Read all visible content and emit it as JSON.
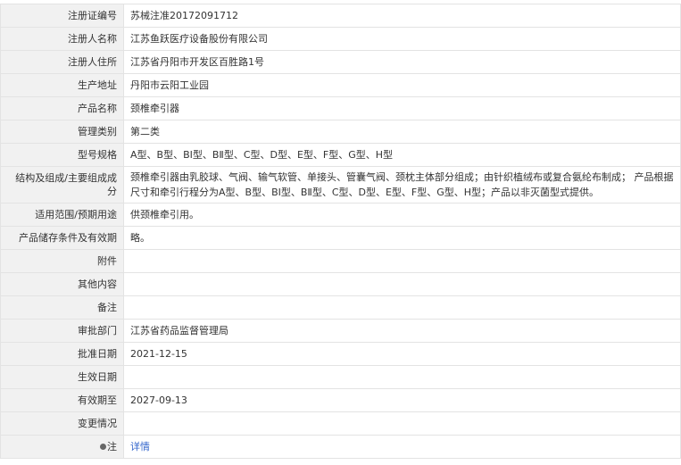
{
  "rows": [
    {
      "label": "注册证编号",
      "value": "苏械注准20172091712"
    },
    {
      "label": "注册人名称",
      "value": "江苏鱼跃医疗设备股份有限公司"
    },
    {
      "label": "注册人住所",
      "value": "江苏省丹阳市开发区百胜路1号"
    },
    {
      "label": "生产地址",
      "value": "丹阳市云阳工业园"
    },
    {
      "label": "产品名称",
      "value": "颈椎牵引器"
    },
    {
      "label": "管理类别",
      "value": "第二类"
    },
    {
      "label": "型号规格",
      "value": "A型、B型、BⅠ型、BⅡ型、C型、D型、E型、F型、G型、H型"
    },
    {
      "label": "结构及组成/主要组成成分",
      "value": "颈椎牵引器由乳胶球、气阀、输气软管、单接头、管囊气阀、颈枕主体部分组成；由针织植绒布或复合氨纶布制成； 产品根据尺寸和牵引行程分为A型、B型、BⅠ型、BⅡ型、C型、D型、E型、F型、G型、H型；产品以非灭菌型式提供。"
    },
    {
      "label": "适用范围/预期用途",
      "value": "供颈椎牵引用。"
    },
    {
      "label": "产品储存条件及有效期",
      "value": "略。"
    },
    {
      "label": "附件",
      "value": ""
    },
    {
      "label": "其他内容",
      "value": ""
    },
    {
      "label": "备注",
      "value": ""
    },
    {
      "label": "审批部门",
      "value": "江苏省药品监督管理局"
    },
    {
      "label": "批准日期",
      "value": "2021-12-15"
    },
    {
      "label": "生效日期",
      "value": ""
    },
    {
      "label": "有效期至",
      "value": "2027-09-13"
    },
    {
      "label": "变更情况",
      "value": ""
    },
    {
      "label": "注",
      "value": "详情"
    }
  ]
}
